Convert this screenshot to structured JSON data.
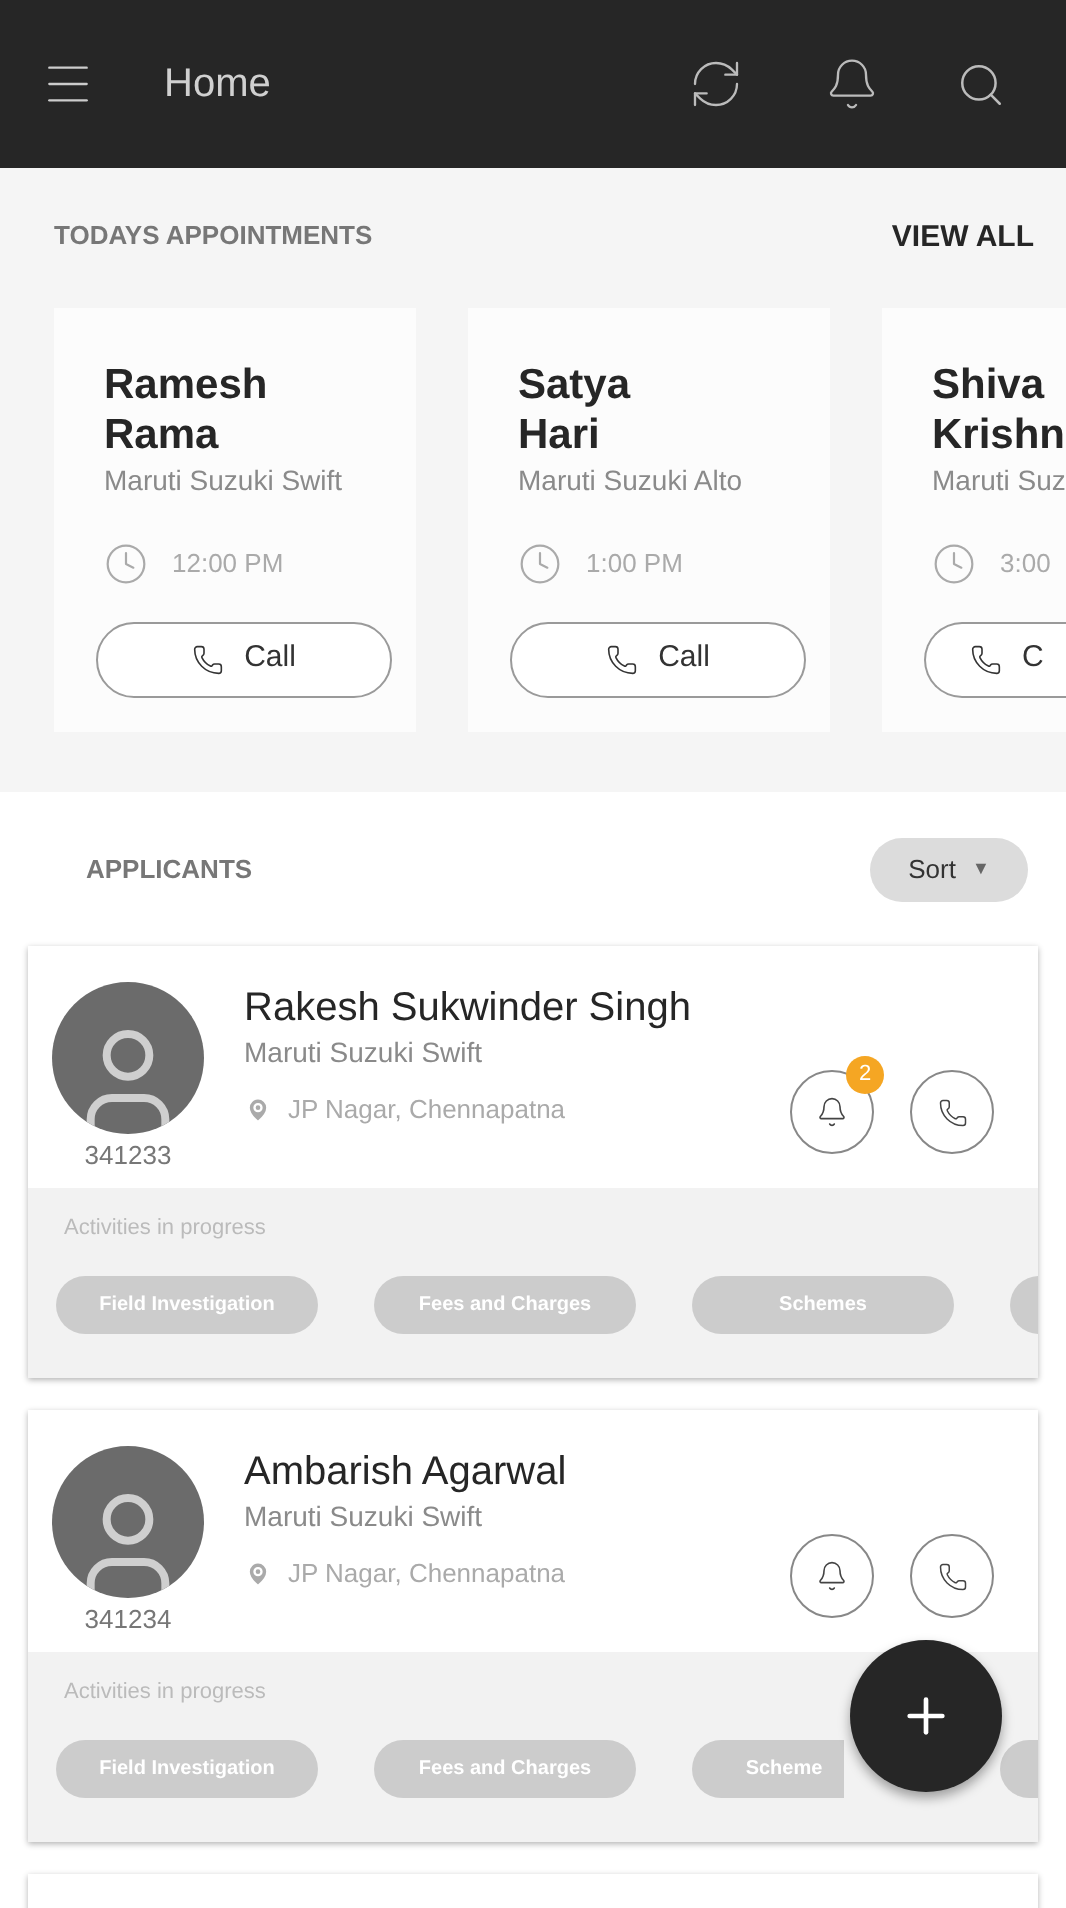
{
  "header": {
    "title": "Home"
  },
  "appointments": {
    "title": "TODAYS APPOINTMENTS",
    "view_all": "VIEW ALL",
    "items": [
      {
        "name": "Ramesh Rama",
        "car": "Maruti Suzuki Swift",
        "time": "12:00 PM",
        "call": "Call",
        "cut": false
      },
      {
        "name": "Satya Hari",
        "car": "Maruti Suzuki Alto",
        "time": "1:00 PM",
        "call": "Call",
        "cut": false
      },
      {
        "name": "Shiva Krishn",
        "car": "Maruti Suz",
        "time": "3:00",
        "call": "C",
        "cut": true
      }
    ]
  },
  "applicants": {
    "title": "APPLICANTS",
    "sort": "Sort",
    "sort_caret": "▼",
    "items": [
      {
        "name": "Rakesh Sukwinder Singh",
        "car": "Maruti Suzuki Swift",
        "location": "JP Nagar, Chennapatna",
        "id": "341233",
        "badge": "2",
        "activities_label": "Activities in progress",
        "chips": [
          {
            "kind": "full",
            "label": "Field Investigation"
          },
          {
            "kind": "full",
            "label": "Fees and Charges"
          },
          {
            "kind": "full",
            "label": "Schemes"
          },
          {
            "kind": "cut"
          }
        ]
      },
      {
        "name": "Ambarish Agarwal",
        "car": "Maruti Suzuki Swift",
        "location": "JP Nagar, Chennapatna",
        "id": "341234",
        "activities_label": "Activities in progress",
        "chips": [
          {
            "kind": "full",
            "label": "Field Investigation"
          },
          {
            "kind": "full",
            "label": "Fees and Charges"
          },
          {
            "kind": "covered",
            "label": "Scheme"
          },
          {
            "kind": "cut"
          }
        ]
      }
    ]
  }
}
